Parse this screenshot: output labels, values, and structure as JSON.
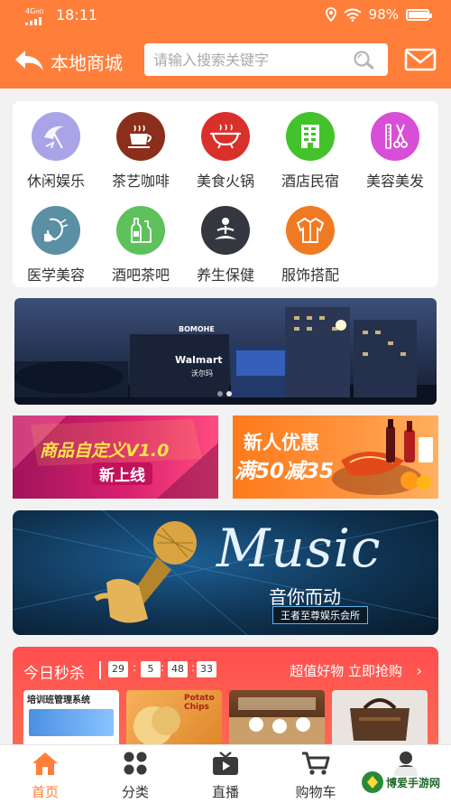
{
  "status_bar": {
    "network": "4G",
    "network_sub": "HD",
    "time": "18:11",
    "battery": "98%",
    "battery_level": 0.98
  },
  "header": {
    "title": "本地商城",
    "search_placeholder": "请输入搜索关键字"
  },
  "categories": [
    {
      "label": "休闲娱乐",
      "icon": "umbrella-icon",
      "color": "#a9a4e8"
    },
    {
      "label": "茶艺咖啡",
      "icon": "coffee-cup-icon",
      "color": "#8b2f1c"
    },
    {
      "label": "美食火锅",
      "icon": "hotpot-icon",
      "color": "#d9302b"
    },
    {
      "label": "酒店民宿",
      "icon": "hotel-icon",
      "color": "#43c22b"
    },
    {
      "label": "美容美发",
      "icon": "scissors-comb-icon",
      "color": "#d94ed6"
    },
    {
      "label": "医学美容",
      "icon": "face-care-icon",
      "color": "#5b8fa3"
    },
    {
      "label": "酒吧茶吧",
      "icon": "bottles-icon",
      "color": "#5ec15b"
    },
    {
      "label": "养生保健",
      "icon": "meditation-icon",
      "color": "#34373f"
    },
    {
      "label": "服饰搭配",
      "icon": "jacket-icon",
      "color": "#f07a22"
    }
  ],
  "banner_main": {
    "sign_text": "Walmart",
    "sign_sub": "沃尔玛",
    "rooftop_text": "BOMOHE"
  },
  "promo_left": {
    "line1": "商品自定义V1.0",
    "line2": "新上线"
  },
  "promo_right": {
    "line1": "新人优惠",
    "line2": "满50减35"
  },
  "music_banner": {
    "title": "Music",
    "subtitle": "音你而动",
    "tagline": "王者至尊娱乐会所"
  },
  "flash_sale": {
    "title": "今日秒杀",
    "countdown": [
      "29",
      "5",
      "48",
      "33"
    ],
    "right_link": "超值好物 立即抢购",
    "goods": [
      {
        "label": "培训班管理系统"
      },
      {
        "label": "Potato Chips"
      },
      {
        "label": ""
      },
      {
        "label": ""
      }
    ]
  },
  "bottom_nav": [
    {
      "label": "首页",
      "icon": "home-icon",
      "active": true
    },
    {
      "label": "分类",
      "icon": "grid-icon",
      "active": false
    },
    {
      "label": "直播",
      "icon": "tv-icon",
      "active": false
    },
    {
      "label": "购物车",
      "icon": "cart-icon",
      "active": false
    },
    {
      "label": "我的",
      "icon": "user-icon",
      "active": false
    }
  ],
  "watermark": "博爱手游网",
  "colors": {
    "primary": "#ff7f3a",
    "flash_red": "#ff4f4f",
    "text": "#333333"
  }
}
